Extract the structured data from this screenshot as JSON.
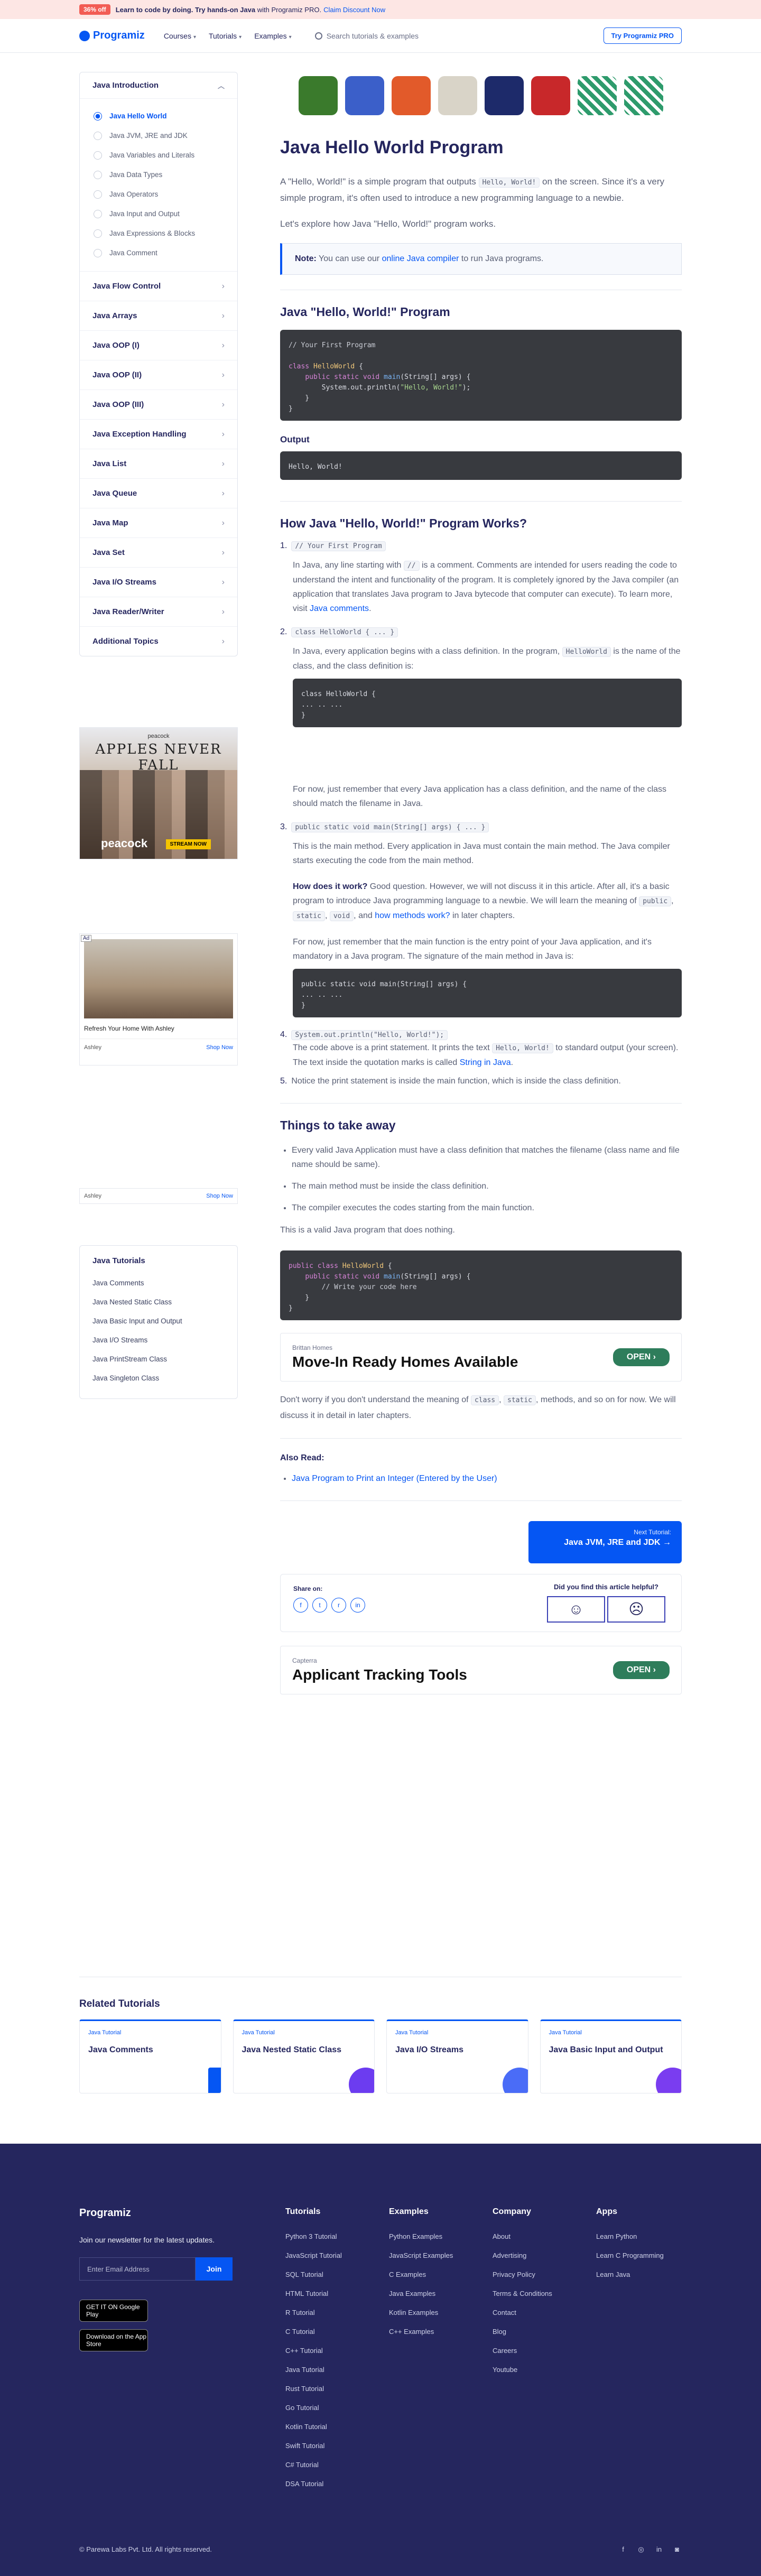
{
  "promo": {
    "badge": "36% off",
    "text_bold": "Learn to code by doing.",
    "text_bold2": "Try hands-on Java",
    "text": "with Programiz PRO.",
    "link": "Claim Discount Now"
  },
  "nav": {
    "logo": "Programiz",
    "courses": "Courses",
    "tutorials": "Tutorials",
    "examples": "Examples",
    "search_placeholder": "Search tutorials & examples",
    "pro_button": "Try Programiz PRO"
  },
  "sidebar": {
    "intro_title": "Java Introduction",
    "intro_items": [
      "Java Hello World",
      "Java JVM, JRE and JDK",
      "Java Variables and Literals",
      "Java Data Types",
      "Java Operators",
      "Java Input and Output",
      "Java Expressions & Blocks",
      "Java Comment"
    ],
    "sections": [
      "Java Flow Control",
      "Java Arrays",
      "Java OOP (I)",
      "Java OOP (II)",
      "Java OOP (III)",
      "Java Exception Handling",
      "Java List",
      "Java Queue",
      "Java Map",
      "Java Set",
      "Java I/O Streams",
      "Java Reader/Writer",
      "Additional Topics"
    ]
  },
  "ads": {
    "peacock_brand": "peacock",
    "peacock_title": "APPLES NEVER FALL",
    "peacock_cta": "STREAM NOW",
    "ad_label": "Ad",
    "ashley_text": "Refresh Your Home With Ashley",
    "ashley_brand": "Ashley",
    "shop_now": "Shop Now",
    "home_brand": "Brittan Homes",
    "home_title": "Move-In Ready Homes Available",
    "open": "OPEN",
    "capterra_brand": "Capterra",
    "capterra_title": "Applicant Tracking Tools"
  },
  "tutorials_box": {
    "title": "Java Tutorials",
    "links": [
      "Java Comments",
      "Java Nested Static Class",
      "Java Basic Input and Output",
      "Java I/O Streams",
      "Java PrintStream Class",
      "Java Singleton Class"
    ]
  },
  "article": {
    "title": "Java Hello World Program",
    "intro_1": "A \"Hello, World!\" is a simple program that outputs",
    "intro_code": "Hello, World!",
    "intro_2": "on the screen. Since it's a very simple program, it's often used to introduce a new programming language to a newbie.",
    "explore": "Let's explore how Java \"Hello, World!\" program works.",
    "note_label": "Note:",
    "note_text": "You can use our",
    "note_link": "online Java compiler",
    "note_tail": "to run Java programs.",
    "h2_program": "Java \"Hello, World!\" Program",
    "output_label": "Output",
    "output_value": "Hello, World!",
    "h2_works": "How Java \"Hello, World!\" Program Works?",
    "step1_code": "// Your First Program",
    "step1_p1": "In Java, any line starting with",
    "step1_code2": "//",
    "step1_p2": "is a comment. Comments are intended for users reading the code to understand the intent and functionality of the program. It is completely ignored by the Java compiler (an application that translates Java program to Java bytecode that computer can execute). To learn more, visit",
    "step1_link": "Java comments",
    "step2_code": "class HelloWorld { ... }",
    "step2_p1": "In Java, every application begins with a class definition. In the program,",
    "step2_code2": "HelloWorld",
    "step2_p2": "is the name of the class, and the class definition is:",
    "step2_p3": "For now, just remember that every Java application has a class definition, and the name of the class should match the filename in Java.",
    "step3_code": "public static void main(String[] args) { ... }",
    "step3_p1": "This is the main method. Every application in Java must contain the main method. The Java compiler starts executing the code from the main method.",
    "step3_q": "How does it work?",
    "step3_p2": "Good question. However, we will not discuss it in this article. After all, it's a basic program to introduce Java programming language to a newbie. We will learn the meaning of",
    "step3_c1": "public",
    "step3_c2": "static",
    "step3_c3": "void",
    "step3_and": ", and",
    "step3_link": "how methods work?",
    "step3_p2b": "in later chapters.",
    "step3_p3": "For now, just remember that the main function is the entry point of your Java application, and it's mandatory in a Java program. The signature of the main method in Java is:",
    "step4_code": "System.out.println(\"Hello, World!\");",
    "step4_p1": "The code above is a print statement. It prints the text",
    "step4_code2": "Hello, World!",
    "step4_p2": "to standard output (your screen). The text inside the quotation marks is called",
    "step4_link": "String in Java",
    "step5": "Notice the print statement is inside the main function, which is inside the class definition.",
    "h2_takeaway": "Things to take away",
    "takeaways": [
      "Every valid Java Application must have a class definition that matches the filename (class name and file name should be same).",
      "The main method must be inside the class definition.",
      "The compiler executes the codes starting from the main function."
    ],
    "valid_text": "This is a valid Java program that does nothing.",
    "dont_worry_1": "Don't worry if you don't understand the meaning of",
    "dont_c1": "class",
    "dont_c2": "static",
    "dont_worry_2": ", methods, and so on for now. We will discuss it in detail in later chapters.",
    "also_read": "Also Read:",
    "also_link": "Java Program to Print an Integer (Entered by the User)",
    "next_label": "Next Tutorial:",
    "next_title": "Java JVM, JRE and JDK",
    "share_label": "Share on:",
    "helpful": "Did you find this article helpful?"
  },
  "related": {
    "title": "Related Tutorials",
    "tag": "Java Tutorial",
    "cards": [
      "Java Comments",
      "Java Nested Static Class",
      "Java I/O Streams",
      "Java Basic Input and Output"
    ]
  },
  "footer": {
    "logo": "Programiz",
    "newsletter": "Join our newsletter for the latest updates.",
    "email_placeholder": "Enter Email Address",
    "join": "Join",
    "google_play": "GET IT ON Google Play",
    "app_store": "Download on the App Store",
    "cols": [
      {
        "title": "Tutorials",
        "links": [
          "Python 3 Tutorial",
          "JavaScript Tutorial",
          "SQL Tutorial",
          "HTML Tutorial",
          "R Tutorial",
          "C Tutorial",
          "C++ Tutorial",
          "Java Tutorial",
          "Rust Tutorial",
          "Go Tutorial",
          "Kotlin Tutorial",
          "Swift Tutorial",
          "C# Tutorial",
          "DSA Tutorial"
        ]
      },
      {
        "title": "Examples",
        "links": [
          "Python Examples",
          "JavaScript Examples",
          "C Examples",
          "Java Examples",
          "Kotlin Examples",
          "C++ Examples"
        ]
      },
      {
        "title": "Company",
        "links": [
          "About",
          "Advertising",
          "Privacy Policy",
          "Terms & Conditions",
          "Contact",
          "Blog",
          "Careers",
          "Youtube"
        ]
      },
      {
        "title": "Apps",
        "links": [
          "Learn Python",
          "Learn C Programming",
          "Learn Java"
        ]
      }
    ],
    "copyright": "© Parewa Labs Pvt. Ltd. All rights reserved."
  }
}
